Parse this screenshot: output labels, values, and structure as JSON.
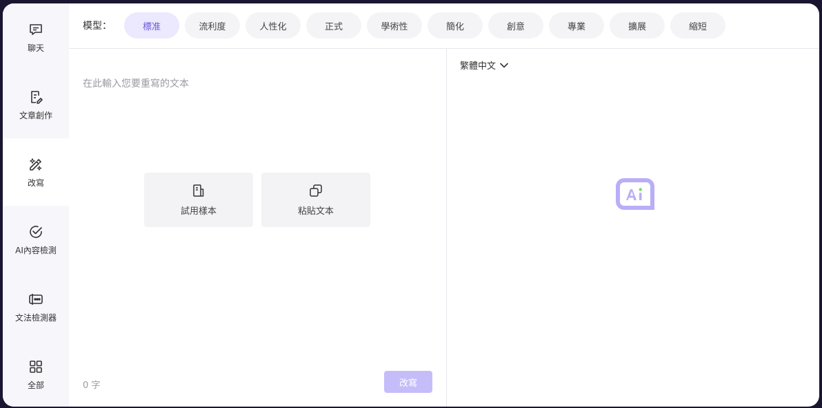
{
  "sidebar": {
    "items": [
      {
        "label": "聊天",
        "icon": "chat-icon"
      },
      {
        "label": "文章創作",
        "icon": "article-edit-icon"
      },
      {
        "label": "改寫",
        "icon": "rewrite-icon"
      },
      {
        "label": "AI內容檢測",
        "icon": "check-circle-icon"
      },
      {
        "label": "文法檢測器",
        "icon": "grammar-check-icon"
      },
      {
        "label": "全部",
        "icon": "grid-icon"
      }
    ]
  },
  "toolbar": {
    "model_label": "模型：",
    "modes": [
      "標准",
      "流利度",
      "人性化",
      "正式",
      "學術性",
      "簡化",
      "創意",
      "專業",
      "擴展",
      "縮短"
    ]
  },
  "editor": {
    "placeholder": "在此輸入您要重寫的文本",
    "try_sample_label": "試用樣本",
    "paste_text_label": "粘貼文本",
    "word_count": "0 字",
    "rewrite_button_label": "改寫"
  },
  "output": {
    "language": "繁體中文",
    "logo_icon": "ai-logo-icon"
  },
  "colors": {
    "accent": "#6a5ae0",
    "accent_light": "#ece8fd",
    "button_disabled": "#c5bdfa",
    "logo": "#b9aef7"
  }
}
